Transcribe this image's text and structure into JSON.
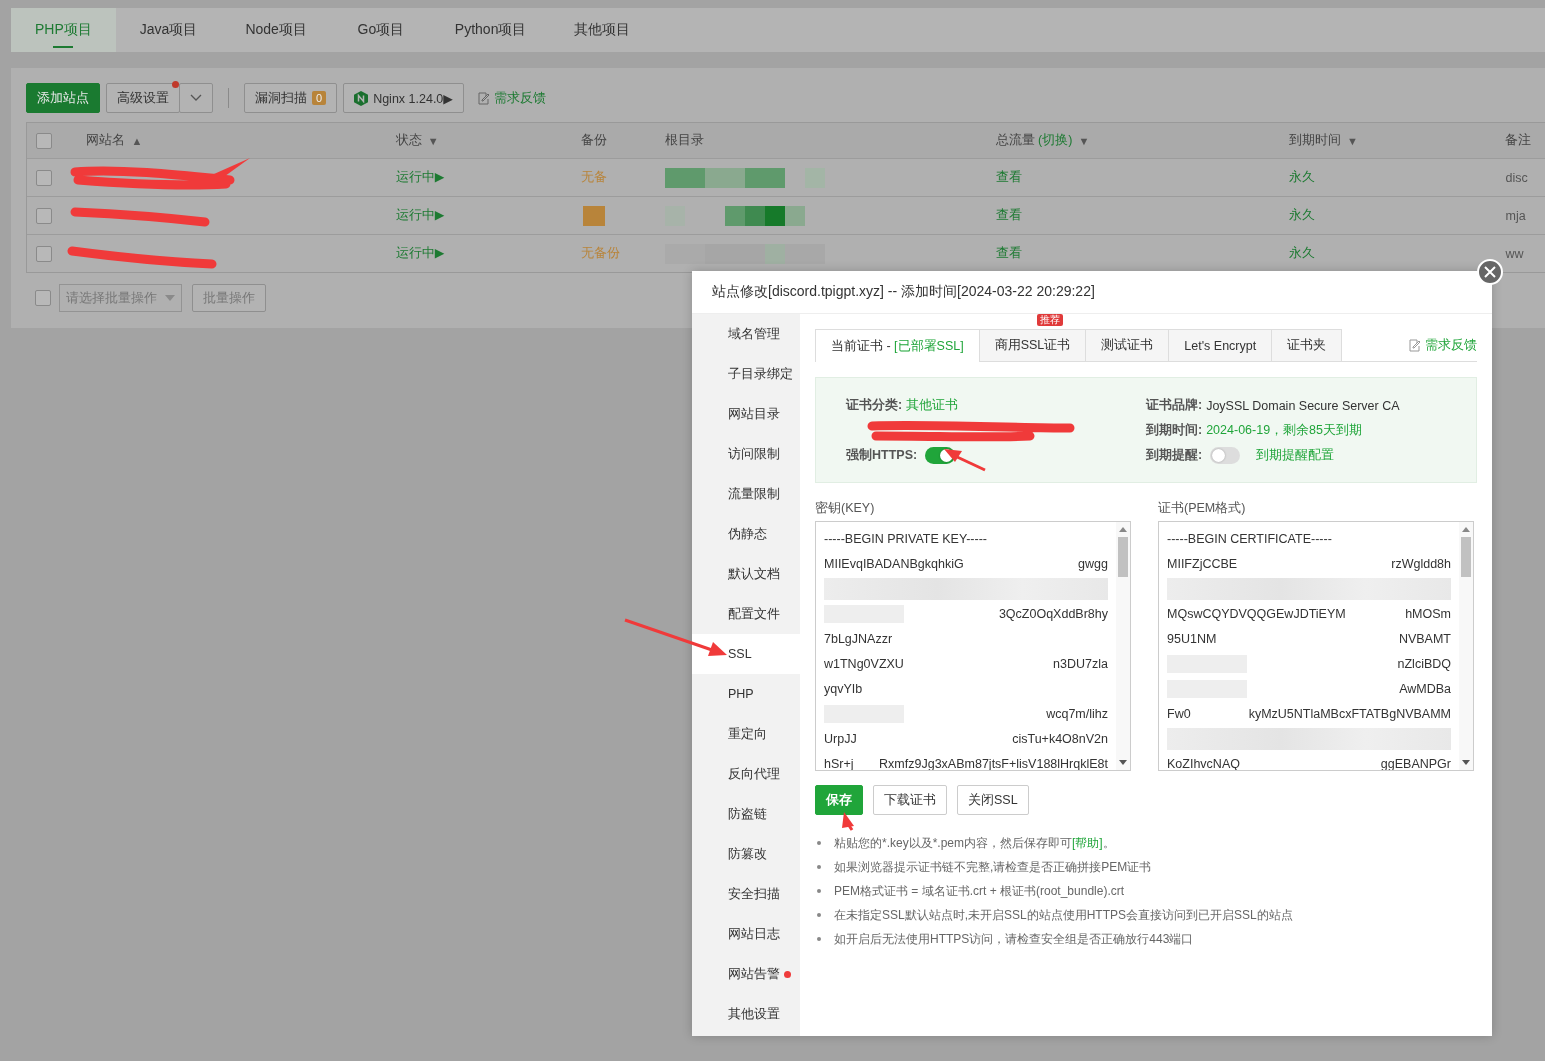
{
  "project_tabs": [
    {
      "label": "PHP项目",
      "selected": true
    },
    {
      "label": "Java项目",
      "selected": false
    },
    {
      "label": "Node项目",
      "selected": false
    },
    {
      "label": "Go项目",
      "selected": false
    },
    {
      "label": "Python项目",
      "selected": false
    },
    {
      "label": "其他项目",
      "selected": false
    }
  ],
  "toolbar": {
    "add_button": "添加站点",
    "advanced_button": "高级设置",
    "advanced_notice": true,
    "scan_button": "漏洞扫描",
    "scan_count": "0",
    "nginx_button": "Nginx 1.24.0▶",
    "feedback_link": "需求反馈"
  },
  "table": {
    "all_checked": false,
    "columns": [
      {
        "label": "网站名",
        "sort": "▲"
      },
      {
        "label": "状态",
        "sort": "▼"
      },
      {
        "label": "备份"
      },
      {
        "label": "根目录"
      },
      {
        "label": "总流量",
        "extra": "(切换)",
        "sort": "▼"
      },
      {
        "label": "到期时间",
        "sort": "▼"
      },
      {
        "label": "备注"
      }
    ],
    "rows": [
      {
        "checked": false,
        "status": "运行中▶",
        "backup": "无备",
        "traffic": "查看",
        "expiry": "永久",
        "note": "disc"
      },
      {
        "checked": false,
        "status": "运行中▶",
        "traffic": "查看",
        "expiry": "永久",
        "note": "mja"
      },
      {
        "checked": false,
        "status": "运行中▶",
        "backup": "无备份",
        "traffic": "查看",
        "expiry": "永久",
        "note": "ww"
      }
    ]
  },
  "batch": {
    "checked": false,
    "placeholder": "请选择批量操作",
    "button": "批量操作"
  },
  "dialog": {
    "title": "站点修改[discord.tpigpt.xyz] -- 添加时间[2024-03-22 20:29:22]",
    "menu": [
      {
        "label": "域名管理",
        "selected": false,
        "notice": false
      },
      {
        "label": "子目录绑定",
        "selected": false,
        "notice": false
      },
      {
        "label": "网站目录",
        "selected": false,
        "notice": false
      },
      {
        "label": "访问限制",
        "selected": false,
        "notice": false
      },
      {
        "label": "流量限制",
        "selected": false,
        "notice": false
      },
      {
        "label": "伪静态",
        "selected": false,
        "notice": false
      },
      {
        "label": "默认文档",
        "selected": false,
        "notice": false
      },
      {
        "label": "配置文件",
        "selected": false,
        "notice": false
      },
      {
        "label": "SSL",
        "selected": true,
        "notice": false
      },
      {
        "label": "PHP",
        "selected": false,
        "notice": false
      },
      {
        "label": "重定向",
        "selected": false,
        "notice": false
      },
      {
        "label": "反向代理",
        "selected": false,
        "notice": false
      },
      {
        "label": "防盗链",
        "selected": false,
        "notice": false
      },
      {
        "label": "防篡改",
        "selected": false,
        "notice": false
      },
      {
        "label": "安全扫描",
        "selected": false,
        "notice": false
      },
      {
        "label": "网站日志",
        "selected": false,
        "notice": false
      },
      {
        "label": "网站告警",
        "selected": false,
        "notice": true
      },
      {
        "label": "其他设置",
        "selected": false,
        "notice": false
      }
    ],
    "ssl_tabs": [
      {
        "label": "当前证书 - ",
        "status": "[已部署SSL]",
        "selected": true
      },
      {
        "label": "商用SSL证书",
        "badge": "推荐",
        "selected": false
      },
      {
        "label": "测试证书",
        "selected": false
      },
      {
        "label": "Let's Encrypt",
        "selected": false
      },
      {
        "label": "证书夹",
        "selected": false
      }
    ],
    "feedback_link": "需求反馈",
    "info": {
      "category_label": "证书分类:",
      "category": "其他证书",
      "https_label": "强制HTTPS:",
      "https_on": true,
      "brand_label": "证书品牌:",
      "brand": "JoySSL Domain Secure Server CA",
      "expiry_label": "到期时间:",
      "expiry": "2024-06-19，剩余85天到期",
      "reminder_label": "到期提醒:",
      "reminder_on": false,
      "reminder_link": "到期提醒配置"
    },
    "key": {
      "label": "密钥(KEY)",
      "lines": [
        {
          "kind": "text",
          "left": "-----BEGIN PRIVATE KEY-----"
        },
        {
          "kind": "text",
          "left": "MIIEvqIBADANBgkqhkiG",
          "right": "gwgg"
        },
        {
          "kind": "blurred"
        },
        {
          "kind": "text",
          "right": "3QcZ0OqXddBr8hy"
        },
        {
          "kind": "text",
          "left": "7bLgJNAzzr"
        },
        {
          "kind": "text",
          "left": "w1TNg0VZXU",
          "right": "n3DU7zla"
        },
        {
          "kind": "text",
          "left": "yqvYIb"
        },
        {
          "kind": "text",
          "right": "wcq7m/lihz"
        },
        {
          "kind": "text",
          "left": "UrpJJ",
          "right": "cisTu+k4O8nV2n"
        },
        {
          "kind": "text",
          "left": "hSr+j",
          "right": "Rxmfz9Jg3xABm87jtsF+lisV188lHrqklE8t"
        }
      ]
    },
    "cert": {
      "label": "证书(PEM格式)",
      "lines": [
        {
          "kind": "text",
          "left": "-----BEGIN CERTIFICATE-----"
        },
        {
          "kind": "text",
          "left": "MIIFZjCCBE",
          "right": "rzWgldd8h"
        },
        {
          "kind": "blurred"
        },
        {
          "kind": "text",
          "left": "MQswCQYDVQQGEwJDTiEYM",
          "right": "hMOSm"
        },
        {
          "kind": "text",
          "left": "95U1NM",
          "right": "NVBAMT"
        },
        {
          "kind": "text",
          "right": "nZlciBDQ"
        },
        {
          "kind": "text",
          "right": "AwMDBa"
        },
        {
          "kind": "text",
          "left": "Fw0",
          "right": "kyMzU5NTlaMBcxFTATBgNVBAMM"
        },
        {
          "kind": "blurred"
        },
        {
          "kind": "text",
          "left": "KoZIhvcNAQ",
          "right": "ggEBANPGr"
        }
      ]
    },
    "buttons": [
      {
        "label": "保存",
        "kind": "primary"
      },
      {
        "label": "下载证书",
        "kind": "default"
      },
      {
        "label": "关闭SSL",
        "kind": "default"
      }
    ],
    "notes": [
      {
        "text": "粘贴您的*.key以及*.pem内容，然后保存即可",
        "link": "[帮助]",
        "suffix": "。"
      },
      {
        "text": "如果浏览器提示证书链不完整,请检查是否正确拼接PEM证书"
      },
      {
        "text": "PEM格式证书 = 域名证书.crt + 根证书(root_bundle).crt"
      },
      {
        "text": "在未指定SSL默认站点时,未开启SSL的站点使用HTTPS会直接访问到已开启SSL的站点"
      },
      {
        "text": "如开启后无法使用HTTPS访问，请检查安全组是否正确放行443端口"
      }
    ]
  }
}
